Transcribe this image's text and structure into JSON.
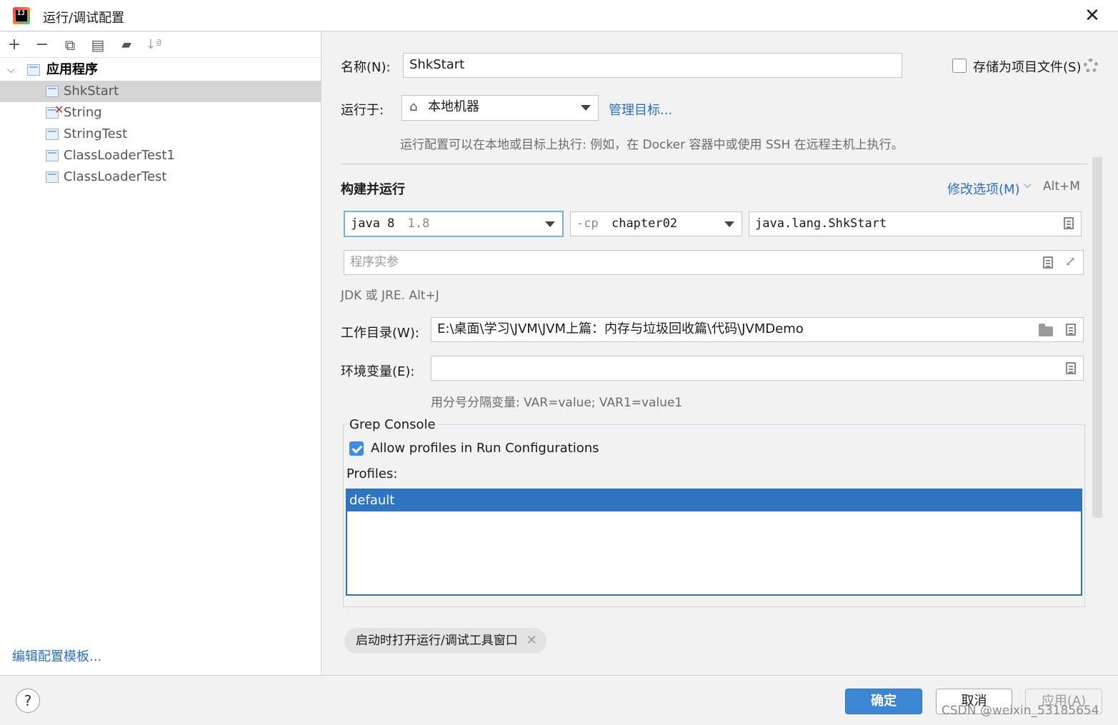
{
  "window": {
    "title": "运行/调试配置",
    "app_icon_text": "IJ"
  },
  "left_toolbar": {
    "add": "+",
    "remove": "−",
    "copy": "⧉",
    "save": "▤",
    "new_folder": "▰",
    "sort": "↓ª"
  },
  "tree": {
    "group_label": "应用程序",
    "items": [
      {
        "label": "ShkStart",
        "selected": true
      },
      {
        "label": "String",
        "error": true,
        "error_mark": "✕"
      },
      {
        "label": "StringTest"
      },
      {
        "label": "ClassLoaderTest1"
      },
      {
        "label": "ClassLoaderTest"
      }
    ]
  },
  "edit_templates_link": "编辑配置模板...",
  "form": {
    "name_label": "名称(N):",
    "name_value": "ShkStart",
    "store_as_project_file": "存储为项目文件(S)",
    "run_on_label": "运行于:",
    "run_on_value": "本地机器",
    "manage_targets": "管理目标...",
    "run_on_hint": "运行配置可以在本地或目标上执行: 例如，在 Docker 容器中或使用 SSH 在远程主机上执行。",
    "build_run_title": "构建并运行",
    "modify_options": "修改选项(M)",
    "modify_shortcut": "Alt+M",
    "jdk_value": "java 8",
    "jdk_version": "1.8",
    "cp_prefix": "-cp",
    "cp_value": "chapter02",
    "main_class": "java.lang.ShkStart",
    "program_args_placeholder": "程序实参",
    "jdk_hint": "JDK 或 JRE. Alt+J",
    "workdir_label": "工作目录(W):",
    "workdir_value": "E:\\桌面\\学习\\JVM\\JVM上篇：内存与垃圾回收篇\\代码\\JVMDemo",
    "env_label": "环境变量(E):",
    "env_value": "",
    "env_hint": "用分号分隔变量: VAR=value; VAR1=value1"
  },
  "grep_console": {
    "title": "Grep Console",
    "allow_profiles": "Allow profiles in Run Configurations",
    "profiles_label": "Profiles:",
    "profiles": [
      "default"
    ]
  },
  "chip": {
    "label": "启动时打开运行/调试工具窗口",
    "close": "✕"
  },
  "buttons": {
    "ok": "确定",
    "cancel": "取消",
    "apply": "应用(A)",
    "help": "?"
  },
  "watermark": "CSDN @weixin_53185654",
  "colors": {
    "accent": "#3d86d3",
    "link": "#2a6ec7",
    "selection": "#2e74c0"
  }
}
